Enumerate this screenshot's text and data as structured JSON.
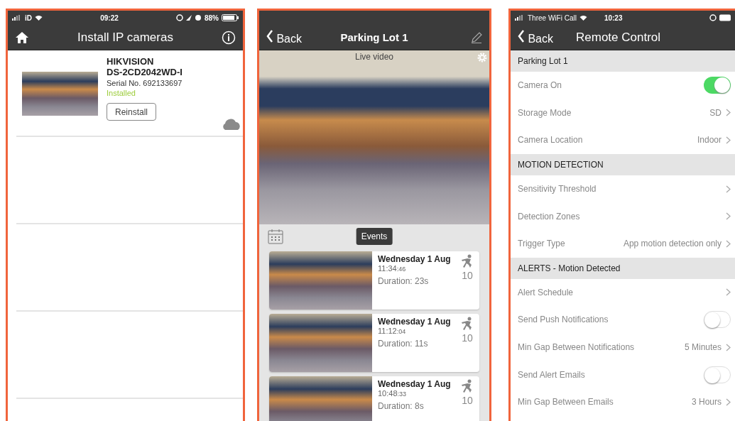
{
  "install_screen": {
    "status_bar": {
      "carrier": "iD",
      "time": "09:22",
      "battery": "88%"
    },
    "title": "Install IP cameras",
    "cameras": [
      {
        "brand": "HIKVISION",
        "model": "DS-2CD2042WD-I",
        "serial": "Serial No. 692133697",
        "status": "Installed",
        "button": "Reinstall"
      }
    ]
  },
  "video_screen": {
    "back": "Back",
    "title": "Parking Lot 1",
    "video_label": "Live video",
    "events_button": "Events",
    "events": [
      {
        "date": "Wednesday 1 Aug",
        "time": "11:34",
        "seconds": ":46",
        "duration": "Duration: 23s",
        "count": "10"
      },
      {
        "date": "Wednesday 1 Aug",
        "time": "11:12",
        "seconds": ":04",
        "duration": "Duration: 11s",
        "count": "10"
      },
      {
        "date": "Wednesday 1 Aug",
        "time": "10:48",
        "seconds": ":33",
        "duration": "Duration: 8s",
        "count": "10"
      }
    ]
  },
  "remote_screen": {
    "status_bar": {
      "carrier": "Three WiFi Call",
      "time": "10:23"
    },
    "back": "Back",
    "title": "Remote Control",
    "rows": [
      {
        "kind": "header",
        "label": "Parking Lot 1"
      },
      {
        "kind": "toggle",
        "label": "Camera On",
        "on": true
      },
      {
        "kind": "value",
        "label": "Storage Mode",
        "value": "SD"
      },
      {
        "kind": "value",
        "label": "Camera Location",
        "value": "Indoor"
      },
      {
        "kind": "header",
        "label": "MOTION DETECTION"
      },
      {
        "kind": "link",
        "label": "Sensitivity Threshold"
      },
      {
        "kind": "link",
        "label": "Detection Zones"
      },
      {
        "kind": "value",
        "label": "Trigger Type",
        "value": "App motion detection only"
      },
      {
        "kind": "header",
        "label": "ALERTS - Motion Detected"
      },
      {
        "kind": "link",
        "label": "Alert Schedule"
      },
      {
        "kind": "toggle",
        "label": "Send Push Notifications",
        "on": false
      },
      {
        "kind": "value",
        "label": "Min Gap Between Notifications",
        "value": "5 Minutes"
      },
      {
        "kind": "toggle",
        "label": "Send Alert Emails",
        "on": false
      },
      {
        "kind": "value",
        "label": "Min Gap Between Emails",
        "value": "3 Hours"
      }
    ]
  }
}
